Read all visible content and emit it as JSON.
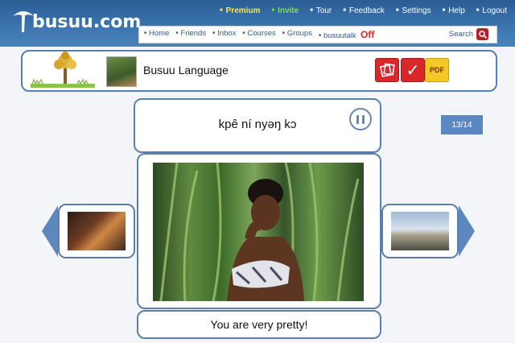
{
  "brand": {
    "logo_text": "busuu.com"
  },
  "topnav": {
    "premium": "Premium",
    "invite": "Invite",
    "tour": "Tour",
    "feedback": "Feedback",
    "settings": "Settings",
    "help": "Help",
    "logout": "Logout"
  },
  "subnav": {
    "links": [
      "Home",
      "Friends",
      "Inbox",
      "Courses",
      "Groups",
      "busuutalk"
    ],
    "busuutalk_status": "Off",
    "search_label": "Search"
  },
  "course": {
    "title": "Busuu Language",
    "pdf_label": "PDF"
  },
  "flashcard": {
    "phrase": "kpê ní nyəŋ kɔ",
    "translation": "You are very pretty!",
    "counter": "13/14"
  },
  "colors": {
    "header_blue": "#3d76b0",
    "frame_blue": "#5a7fae",
    "premium_yellow": "#f6ea3a",
    "invite_green": "#7fe04e",
    "off_red": "#e0231b"
  },
  "icons": [
    "tree-logo-icon",
    "search-icon",
    "flashcards-icon",
    "check-icon",
    "pdf-icon",
    "pause-icon",
    "prev-arrow-icon",
    "next-arrow-icon"
  ]
}
